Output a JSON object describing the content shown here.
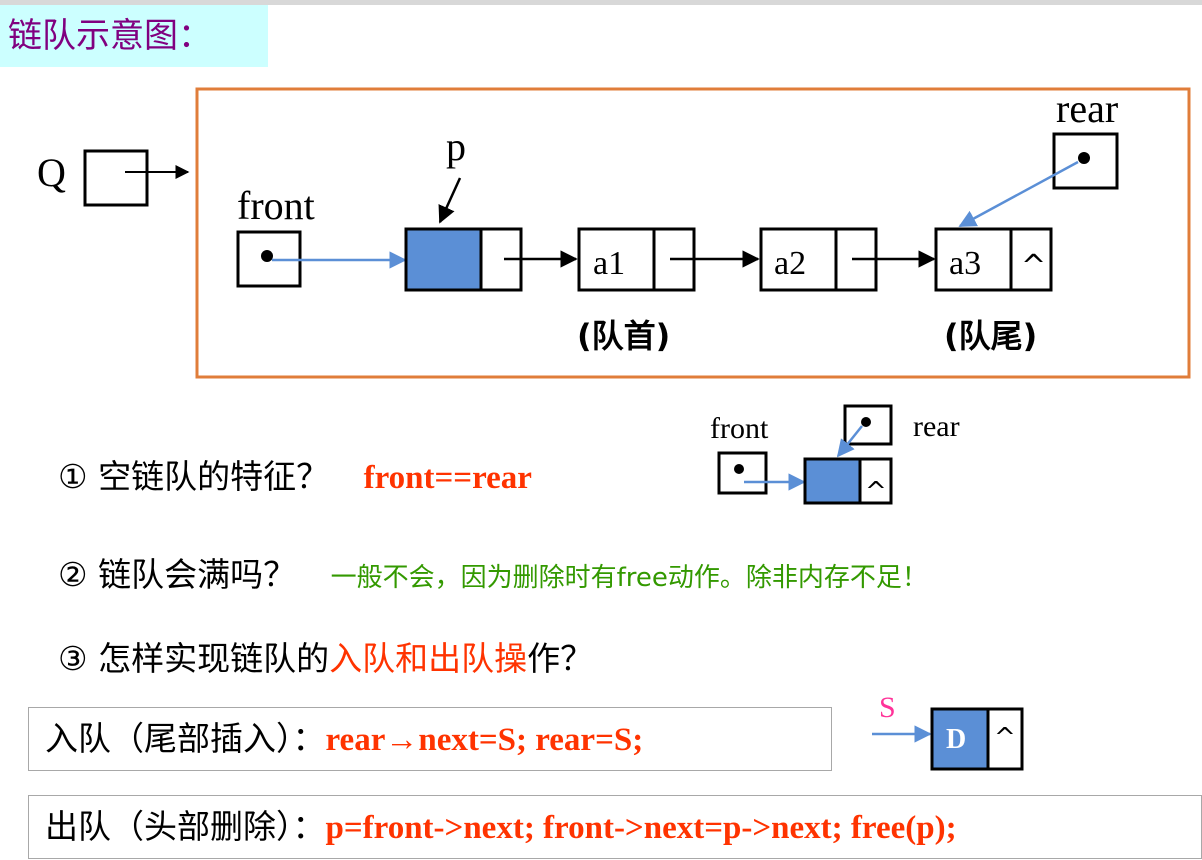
{
  "title": "链队示意图：",
  "diagram": {
    "q_label": "Q",
    "front_label": "front",
    "rear_label": "rear",
    "p_label": "p",
    "nodes": [
      "a1",
      "a2",
      "a3"
    ],
    "null_symbol": "^",
    "head_label": "(队首)",
    "tail_label": "(队尾)"
  },
  "empty_diagram": {
    "front_label": "front",
    "rear_label": "rear",
    "null_symbol": "^"
  },
  "questions": {
    "q1": {
      "text": "① 空链队的特征？",
      "answer": "front==rear"
    },
    "q2": {
      "text": "② 链队会满吗？",
      "answer": "一般不会，因为删除时有free动作。除非内存不足！"
    },
    "q3": {
      "text_before": "③ 怎样实现链队的",
      "highlight": "入队和出队操",
      "text_after": "作？"
    }
  },
  "enqueue": {
    "label": "入队（尾部插入）：",
    "code": "rear→next=S; rear=S;",
    "s_label": "S",
    "node_value": "D",
    "null_symbol": "^"
  },
  "dequeue": {
    "label": "出队（头部删除）：",
    "code": "p=front->next; front->next=p->next; free(p);"
  },
  "colors": {
    "title_bg": "#ccffff",
    "title_text": "#800080",
    "frame": "#e07d3a",
    "node_fill": "#5b8fd6",
    "pointer": "#5b8fd6",
    "code_red": "#ff3300",
    "answer_green": "#339900",
    "s_pink": "#ff3399"
  }
}
